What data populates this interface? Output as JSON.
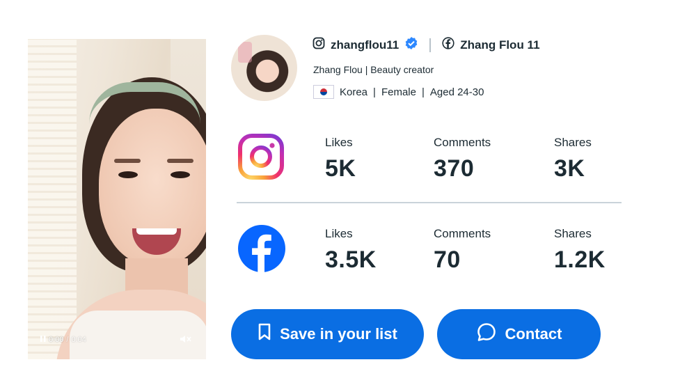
{
  "video": {
    "time_current": "0:00",
    "time_total": "0:04",
    "play_state_icon": "pause-icon",
    "mute_icon": "muted-speaker-icon"
  },
  "profile": {
    "instagram_handle": "zhangflou11",
    "verified": true,
    "facebook_name": "Zhang Flou 11",
    "name": "Zhang Flou",
    "category": "Beauty creator",
    "country": "Korea",
    "gender": "Female",
    "age": "Aged 24-30"
  },
  "stats": {
    "instagram": {
      "likes_label": "Likes",
      "likes": "5K",
      "comments_label": "Comments",
      "comments": "370",
      "shares_label": "Shares",
      "shares": "3K"
    },
    "facebook": {
      "likes_label": "Likes",
      "likes": "3.5K",
      "comments_label": "Comments",
      "comments": "70",
      "shares_label": "Shares",
      "shares": "1.2K"
    }
  },
  "actions": {
    "save_label": "Save in your list",
    "contact_label": "Contact"
  },
  "colors": {
    "primary_button": "#0a6ee3",
    "facebook_blue": "#0866ff",
    "verified_badge": "#2d88ff",
    "text": "#1c2b33"
  }
}
